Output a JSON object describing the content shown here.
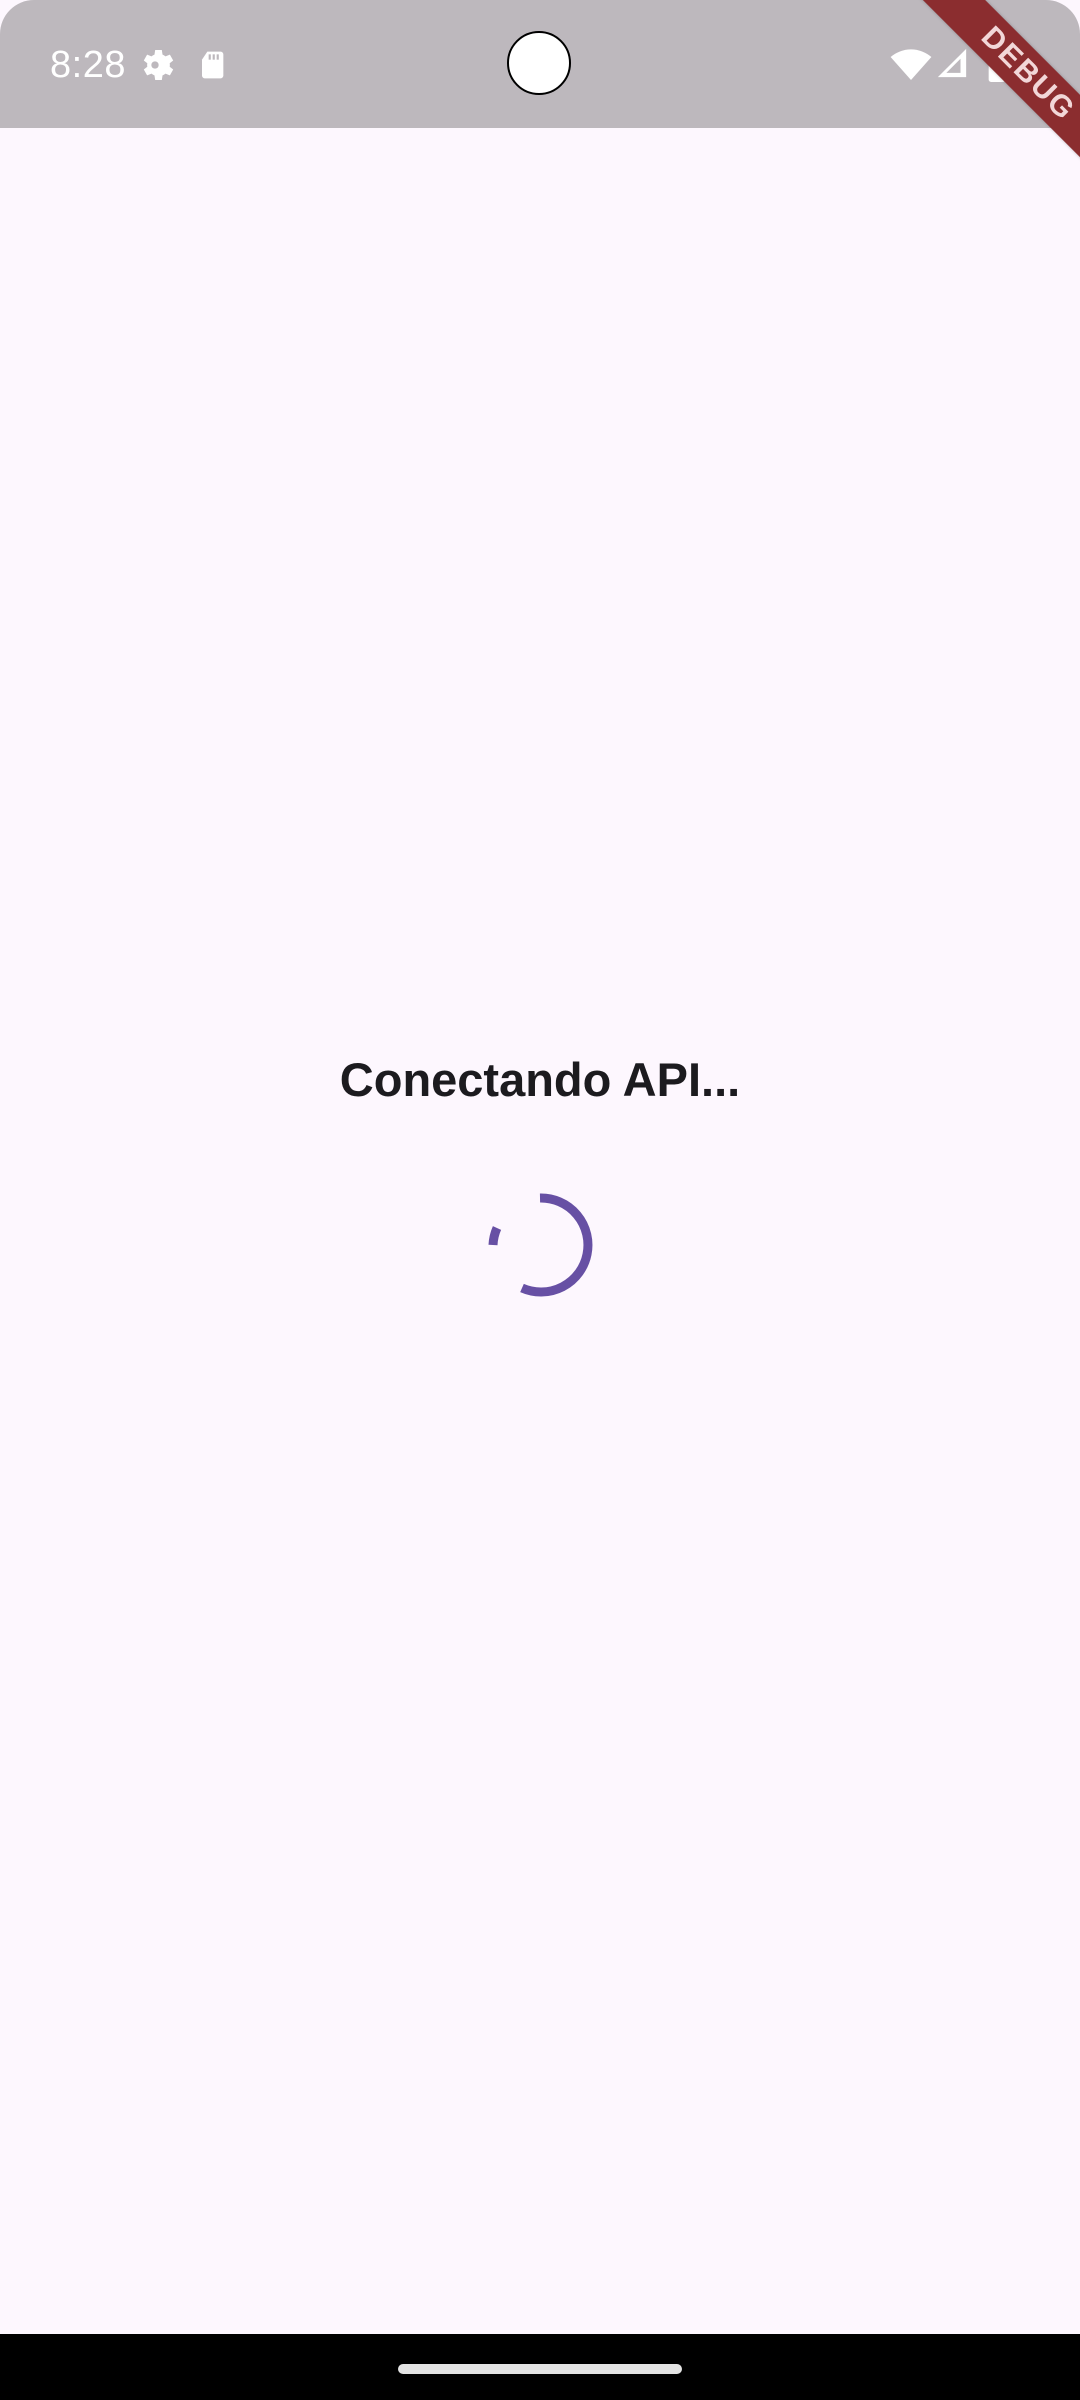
{
  "status_bar": {
    "time": "8:28",
    "left_icons": [
      "gear-icon",
      "sd-card-icon"
    ],
    "right_icons": [
      "wifi-icon",
      "signal-icon",
      "battery-icon"
    ]
  },
  "debug": {
    "label": "DEBUG"
  },
  "content": {
    "title": "Conectando API..."
  },
  "colors": {
    "status_bar_bg": "#bdb8bd",
    "screen_bg": "#fdf7fe",
    "title_text": "#1c1b1f",
    "spinner": "#6750a4",
    "debug_bg": "#8b2d2f",
    "nav_bar": "#000000",
    "home_indicator": "#e4e4e4"
  }
}
